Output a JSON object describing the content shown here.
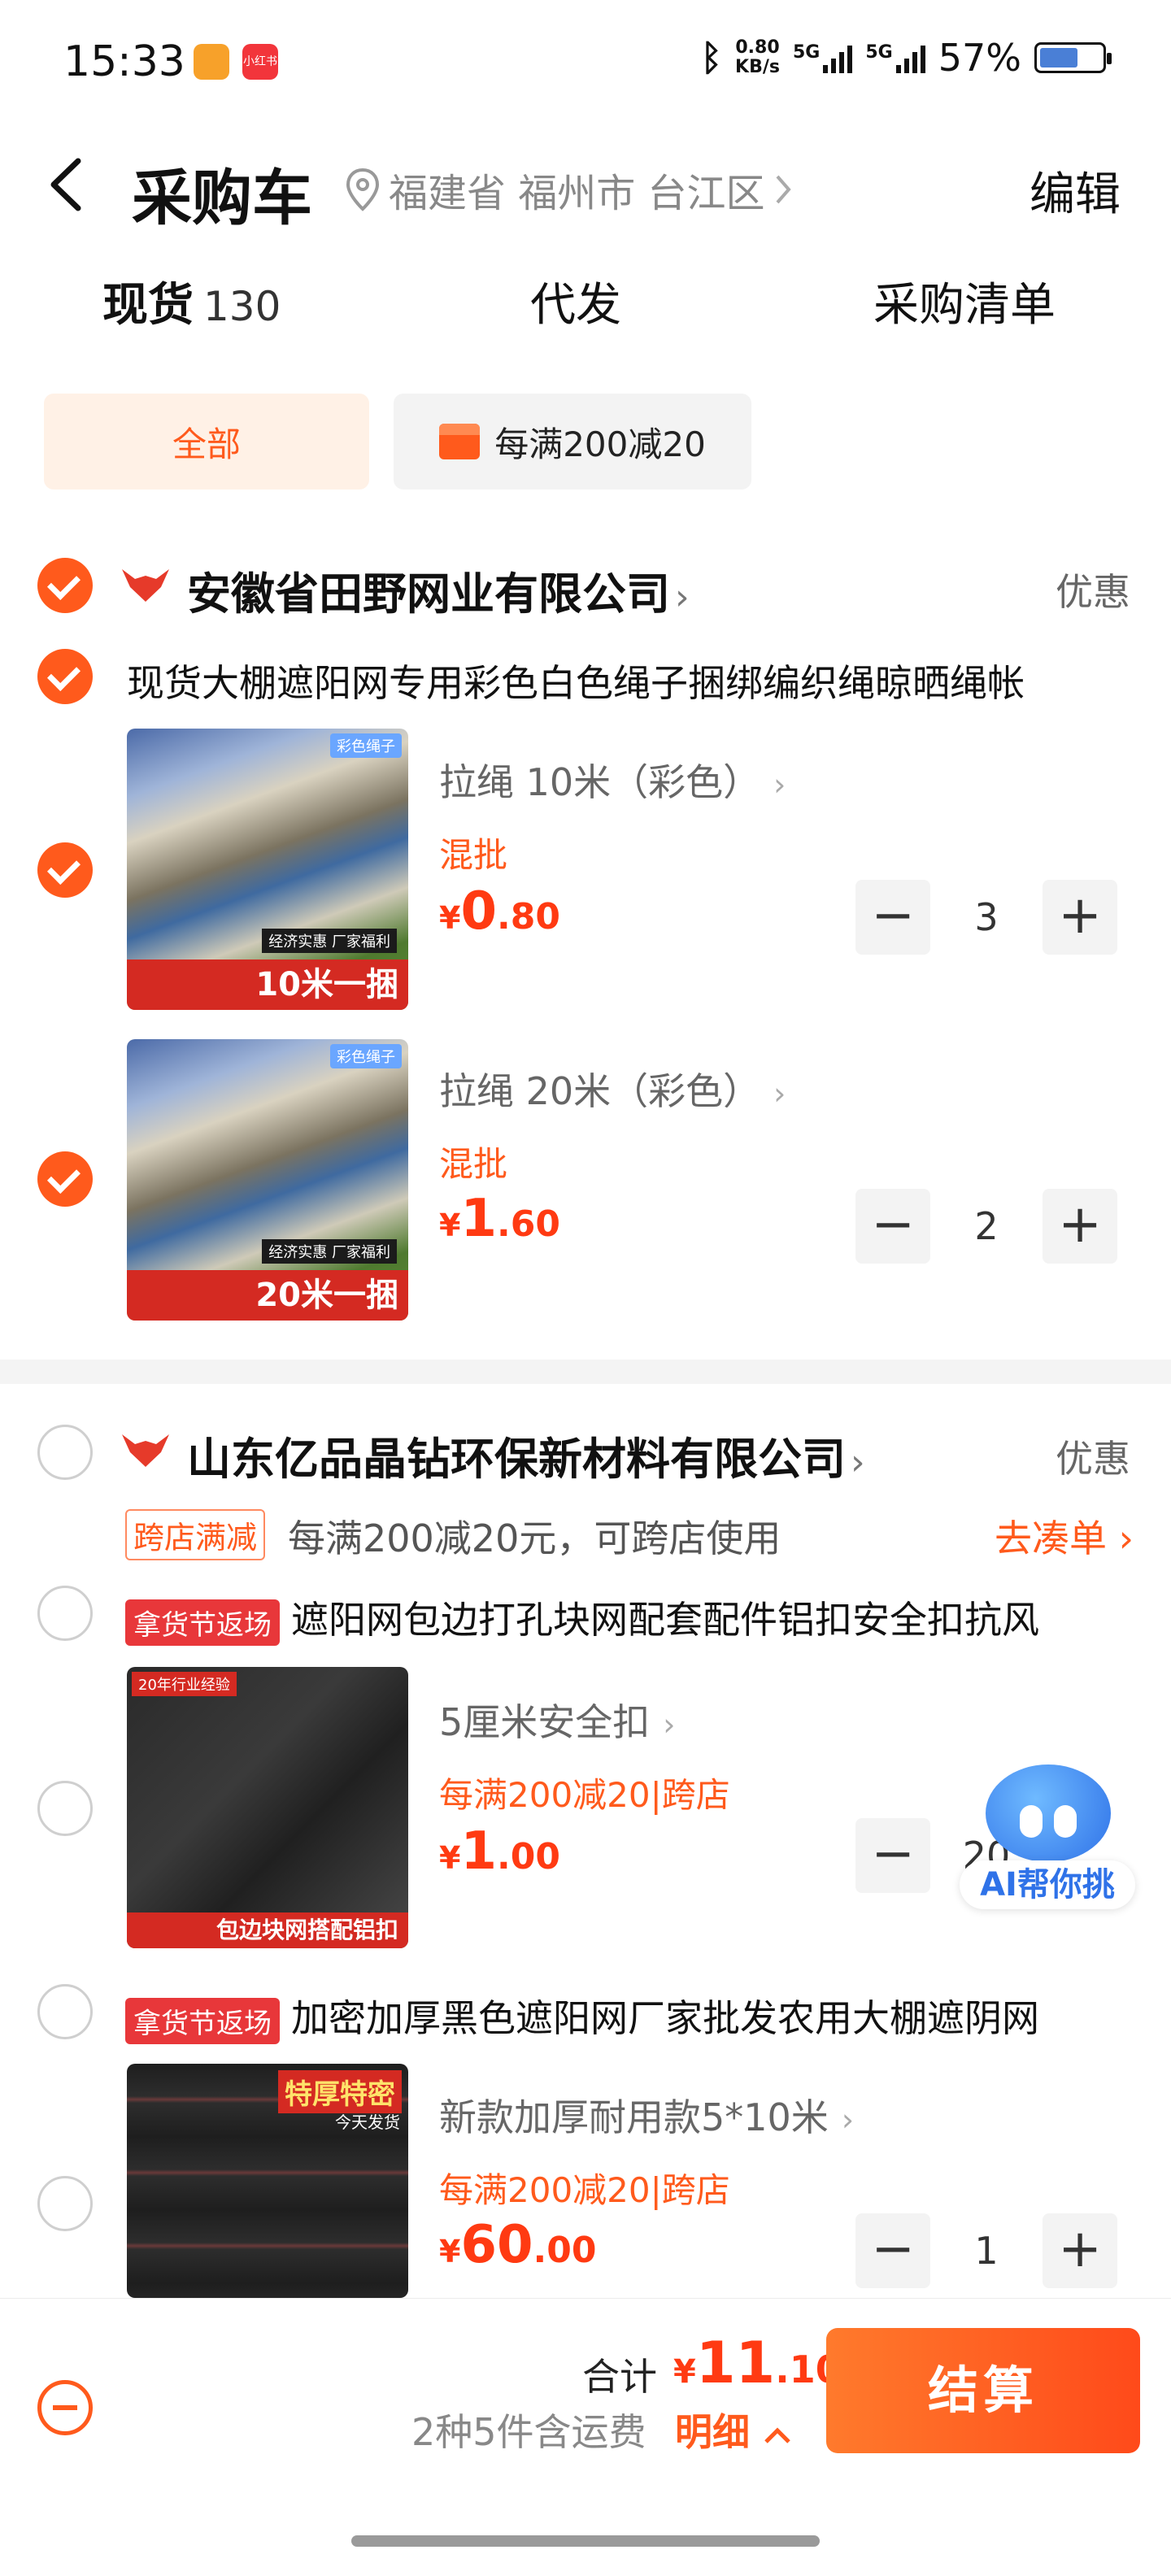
{
  "status_bar": {
    "time": "15:33",
    "app_icon_2": "小红书",
    "net_speed": "0.80",
    "net_unit": "KB/s",
    "sig1": "5G",
    "sig2": "5G",
    "battery": "57%"
  },
  "header": {
    "title": "采购车",
    "location": "福建省 福州市 台江区",
    "edit": "编辑"
  },
  "tabs": [
    {
      "label": "现货",
      "count": "130"
    },
    {
      "label": "代发"
    },
    {
      "label": "采购清单"
    }
  ],
  "filters": {
    "all": "全部",
    "promo": "每满200减20"
  },
  "shop1": {
    "name": "安徽省田野网业有限公司",
    "promo": "优惠",
    "product_title": "现货大棚遮阳网专用彩色白色绳子捆绑编织绳晾晒绳帐",
    "items": [
      {
        "thumb_badge": "彩色绳子",
        "thumb_sub": "经济实惠 厂家福利",
        "thumb_banner": "10米一捆",
        "spec": "拉绳 10米（彩色）",
        "mix": "混批",
        "price_int": "0",
        "price_dec": ".80",
        "qty": "3"
      },
      {
        "thumb_badge": "彩色绳子",
        "thumb_sub": "经济实惠 厂家福利",
        "thumb_banner": "20米一捆",
        "spec": "拉绳 20米（彩色）",
        "mix": "混批",
        "price_int": "1",
        "price_dec": ".60",
        "qty": "2"
      }
    ]
  },
  "shop2": {
    "name": "山东亿品晶钻环保新材料有限公司",
    "promo": "优惠",
    "cross_tag": "跨店满减",
    "cross_text": "每满200减20元，可跨店使用",
    "cross_link": "去凑单",
    "products": [
      {
        "tag": "拿货节返场",
        "title": "遮阳网包边打孔块网配套配件铝扣安全扣抗风",
        "thumb_top": "20年行业经验",
        "thumb_banner": "包边块网搭配铝扣",
        "spec": "5厘米安全扣",
        "mix": "每满200减20|跨店",
        "price_int": "1",
        "price_dec": ".00",
        "qty": "20"
      },
      {
        "tag": "拿货节返场",
        "title": "加密加厚黑色遮阳网厂家批发农用大棚遮阴网",
        "thumb_top": "特厚特密",
        "thumb_banner": "今天发货",
        "spec": "新款加厚耐用款5*10米",
        "mix": "每满200减20|跨店",
        "price_int": "60",
        "price_dec": ".00",
        "qty": "1"
      }
    ]
  },
  "ai": {
    "label": "AI帮你挑"
  },
  "bottom": {
    "total_label": "合计",
    "currency": "¥",
    "total_int": "11",
    "total_dec": ".10",
    "summary": "2种5件含运费",
    "detail": "明细",
    "checkout": "结算"
  },
  "colors": {
    "accent": "#ff5a1c",
    "price": "#ff3a12",
    "ai": "#2f72e8"
  }
}
